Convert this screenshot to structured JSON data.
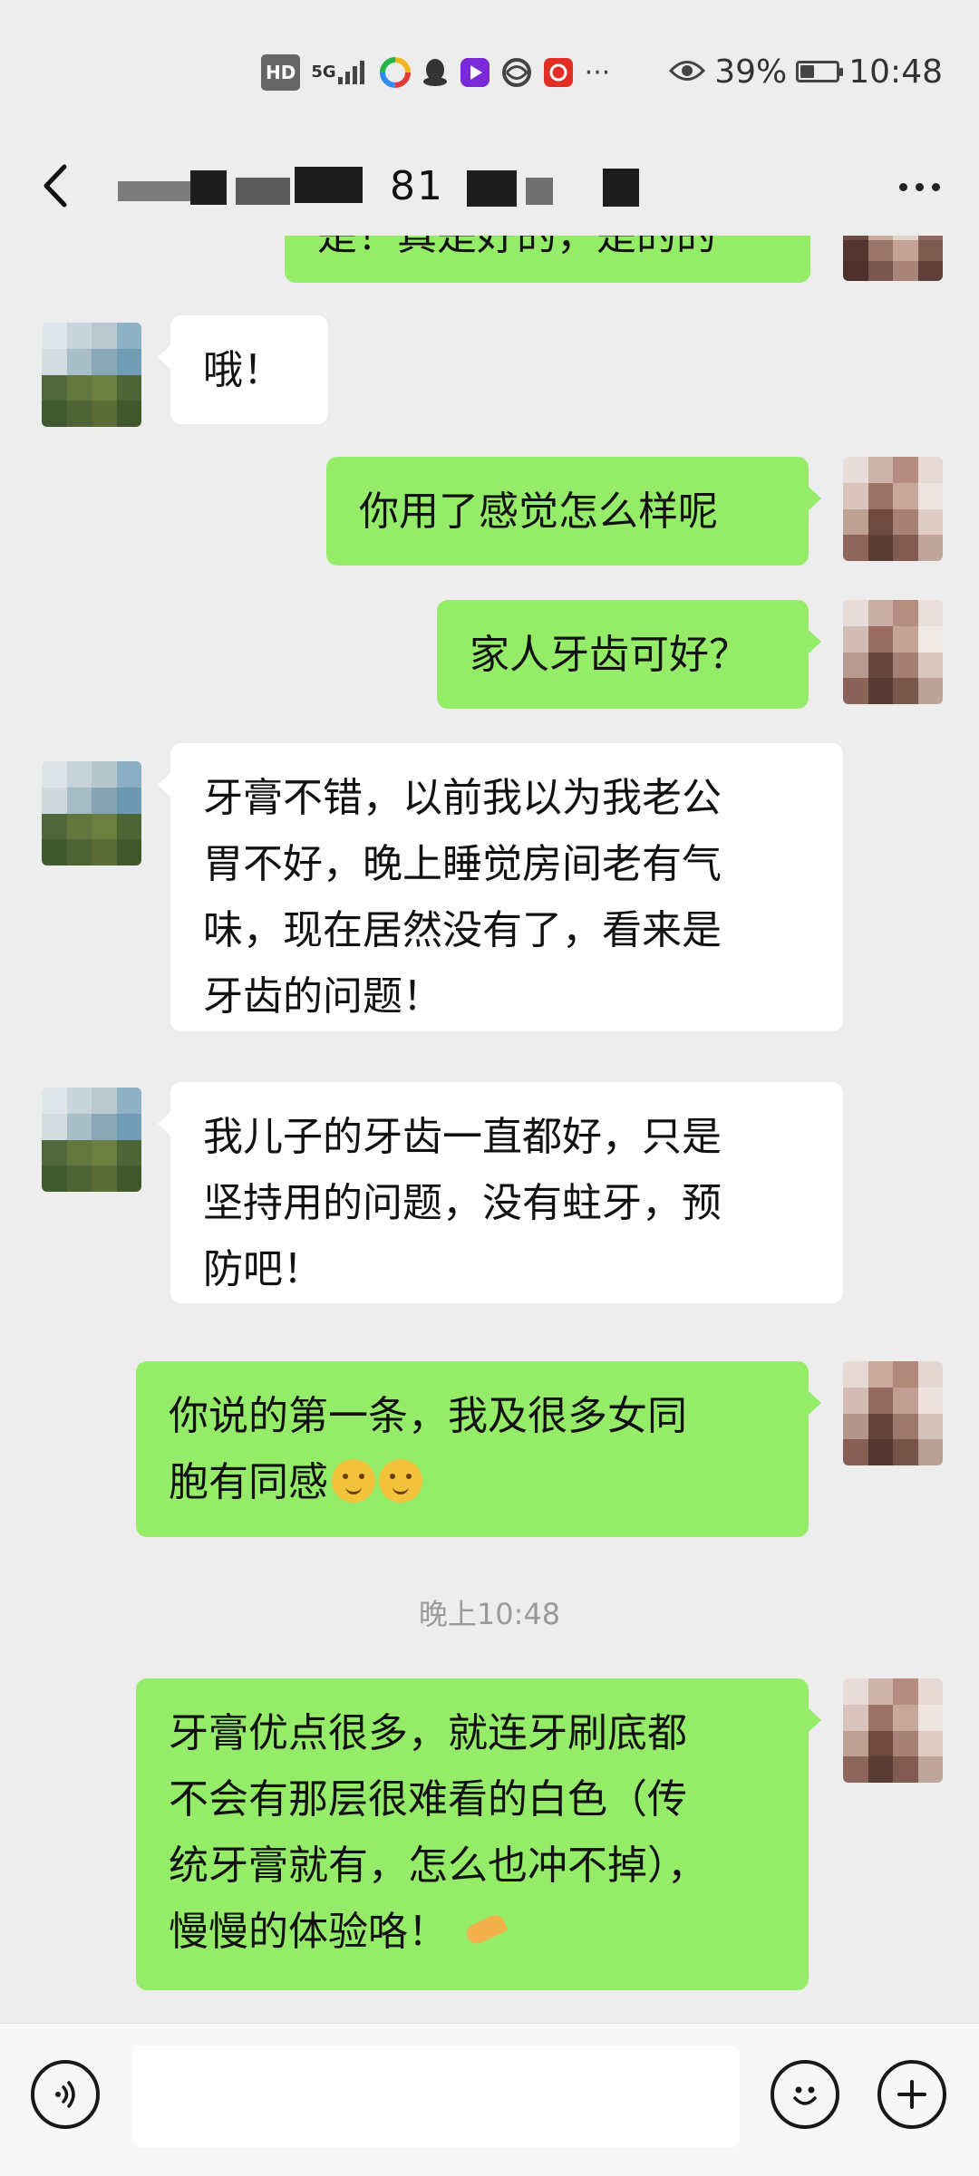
{
  "status_bar": {
    "left_icons": [
      "hd-icon",
      "5g-signal-icon",
      "app-icon",
      "qq-icon",
      "video-app-icon",
      "browser-icon",
      "pinduoduo-icon",
      "more-icon"
    ],
    "hd": "HD",
    "network": "5G",
    "more": "···",
    "battery_percent_text": "39%",
    "battery_level": 0.39,
    "time": "10:48"
  },
  "header": {
    "title_visible": "81",
    "back_icon": "chevron-left-icon",
    "more_icon": "more-dots-icon"
  },
  "messages": [
    {
      "side": "out",
      "text": "是！真是好的，是的的",
      "partial": true
    },
    {
      "side": "in",
      "text": "哦！"
    },
    {
      "side": "out",
      "text": "你用了感觉怎么样呢"
    },
    {
      "side": "out",
      "text": "家人牙齿可好？"
    },
    {
      "side": "in",
      "lines": [
        "牙膏不错，以前我以为我老公",
        "胃不好，晚上睡觉房间老有气",
        "味，现在居然没有了，看来是",
        "牙齿的问题！"
      ]
    },
    {
      "side": "in",
      "lines": [
        "我儿子的牙齿一直都好，只是",
        "坚持用的问题，没有蛀牙，预",
        "防吧！"
      ]
    },
    {
      "side": "out",
      "lines": [
        "你说的第一条，我及很多女同",
        "胞有同感"
      ],
      "emojis": [
        "thinking-face-emoji",
        "shushing-face-emoji"
      ]
    },
    {
      "side": "out",
      "lines": [
        "牙膏优点很多，就连牙刷底都",
        "不会有那层很难看的白色（传",
        "统牙膏就有，怎么也冲不掉），",
        "慢慢的体验咯！"
      ],
      "emojis": [
        "pointing-hand-emoji"
      ]
    }
  ],
  "timestamp": "晚上10:48",
  "input_bar": {
    "voice_icon": "voice-icon",
    "emoji_icon": "emoji-icon",
    "plus_icon": "plus-icon"
  },
  "colors": {
    "background": "#ededed",
    "outgoing_bubble": "#95ec69",
    "incoming_bubble": "#ffffff"
  }
}
